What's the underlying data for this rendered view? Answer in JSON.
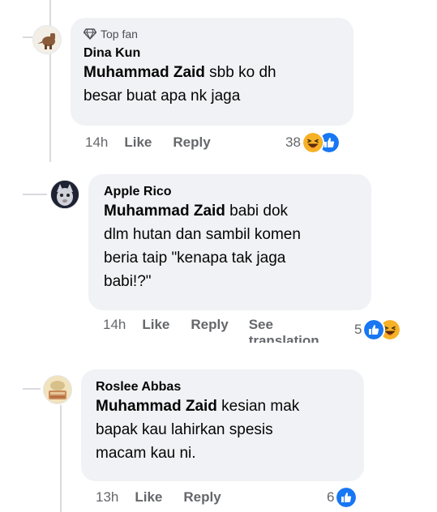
{
  "comments": [
    {
      "badge": "Top fan",
      "author": "Dina Kun",
      "mention": "Muhammad Zaid",
      "text_lines": [
        " sbb ko dh",
        "besar buat apa nk jaga"
      ],
      "time": "14h",
      "like_label": "Like",
      "reply_label": "Reply",
      "reaction_count": "38",
      "reactions": [
        "haha",
        "like"
      ]
    },
    {
      "author": "Apple Rico",
      "mention": "Muhammad Zaid",
      "text_lines": [
        " babi dok",
        "dlm hutan dan sambil komen",
        "beria taip \"kenapa tak jaga",
        "babi!?\""
      ],
      "time": "14h",
      "like_label": "Like",
      "reply_label": "Reply",
      "see_translation": [
        "See",
        "translation"
      ],
      "reaction_count": "5",
      "reactions": [
        "like",
        "haha"
      ]
    },
    {
      "author": "Roslee Abbas",
      "mention": "Muhammad Zaid",
      "text_lines": [
        " kesian mak",
        "bapak kau lahirkan spesis",
        "macam kau ni."
      ],
      "time": "13h",
      "like_label": "Like",
      "reply_label": "Reply",
      "reaction_count": "6",
      "reactions": [
        "like"
      ]
    }
  ],
  "colors": {
    "bubble": "#f0f2f5",
    "meta": "#65676b",
    "like_blue": "#1877f2",
    "haha_yellow": "#f7b125",
    "thread_line": "#d8dadf"
  }
}
